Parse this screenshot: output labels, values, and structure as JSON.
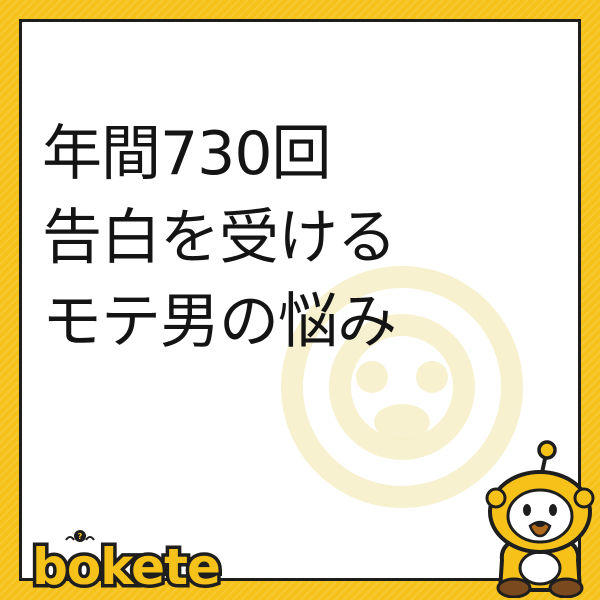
{
  "caption": {
    "lines": [
      "年間730回",
      "告白を受ける",
      "モテ男の悩み"
    ]
  },
  "brand": {
    "logo_text": "bokete",
    "mascot_icon": "boketeko-mascot-icon",
    "watermark_icon": "mascot-watermark-icon"
  },
  "colors": {
    "frame": "#f6c21a",
    "panel": "#ffffff",
    "text": "#141414",
    "logo_fill": "#f6c21a",
    "logo_outline": "#1e1e1e"
  }
}
